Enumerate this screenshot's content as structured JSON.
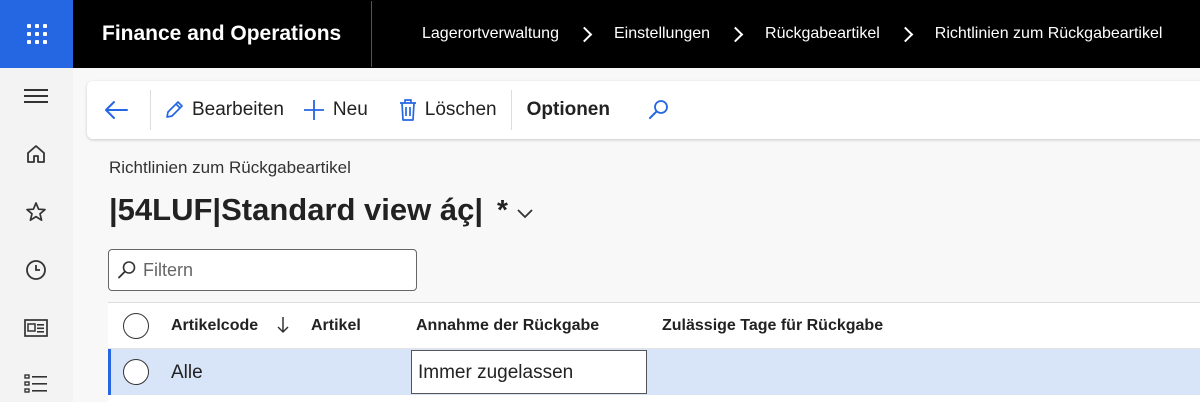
{
  "app": {
    "title": "Finance and Operations"
  },
  "breadcrumb": [
    "Lagerortverwaltung",
    "Einstellungen",
    "Rückgabeartikel",
    "Richtlinien zum Rückgabeartikel"
  ],
  "toolbar": {
    "edit_label": "Bearbeiten",
    "new_label": "Neu",
    "delete_label": "Löschen",
    "options_label": "Optionen"
  },
  "page": {
    "caption": "Richtlinien zum Rückgabeartikel",
    "view_name": "|54LUF|Standard view áç|",
    "modified_marker": "*"
  },
  "filter": {
    "placeholder": "Filtern"
  },
  "grid": {
    "columns": [
      "Artikelcode",
      "Artikel",
      "Annahme der Rückgabe",
      "Zulässige Tage für Rückgabe"
    ],
    "sort_column": "Artikelcode",
    "rows": [
      {
        "item_code": "Alle",
        "item": "",
        "acceptance": "Immer zugelassen",
        "allowed_days": ""
      }
    ]
  },
  "colors": {
    "accent": "#2566e3",
    "topbar": "#000000",
    "selected_row": "#d8e4f7"
  }
}
